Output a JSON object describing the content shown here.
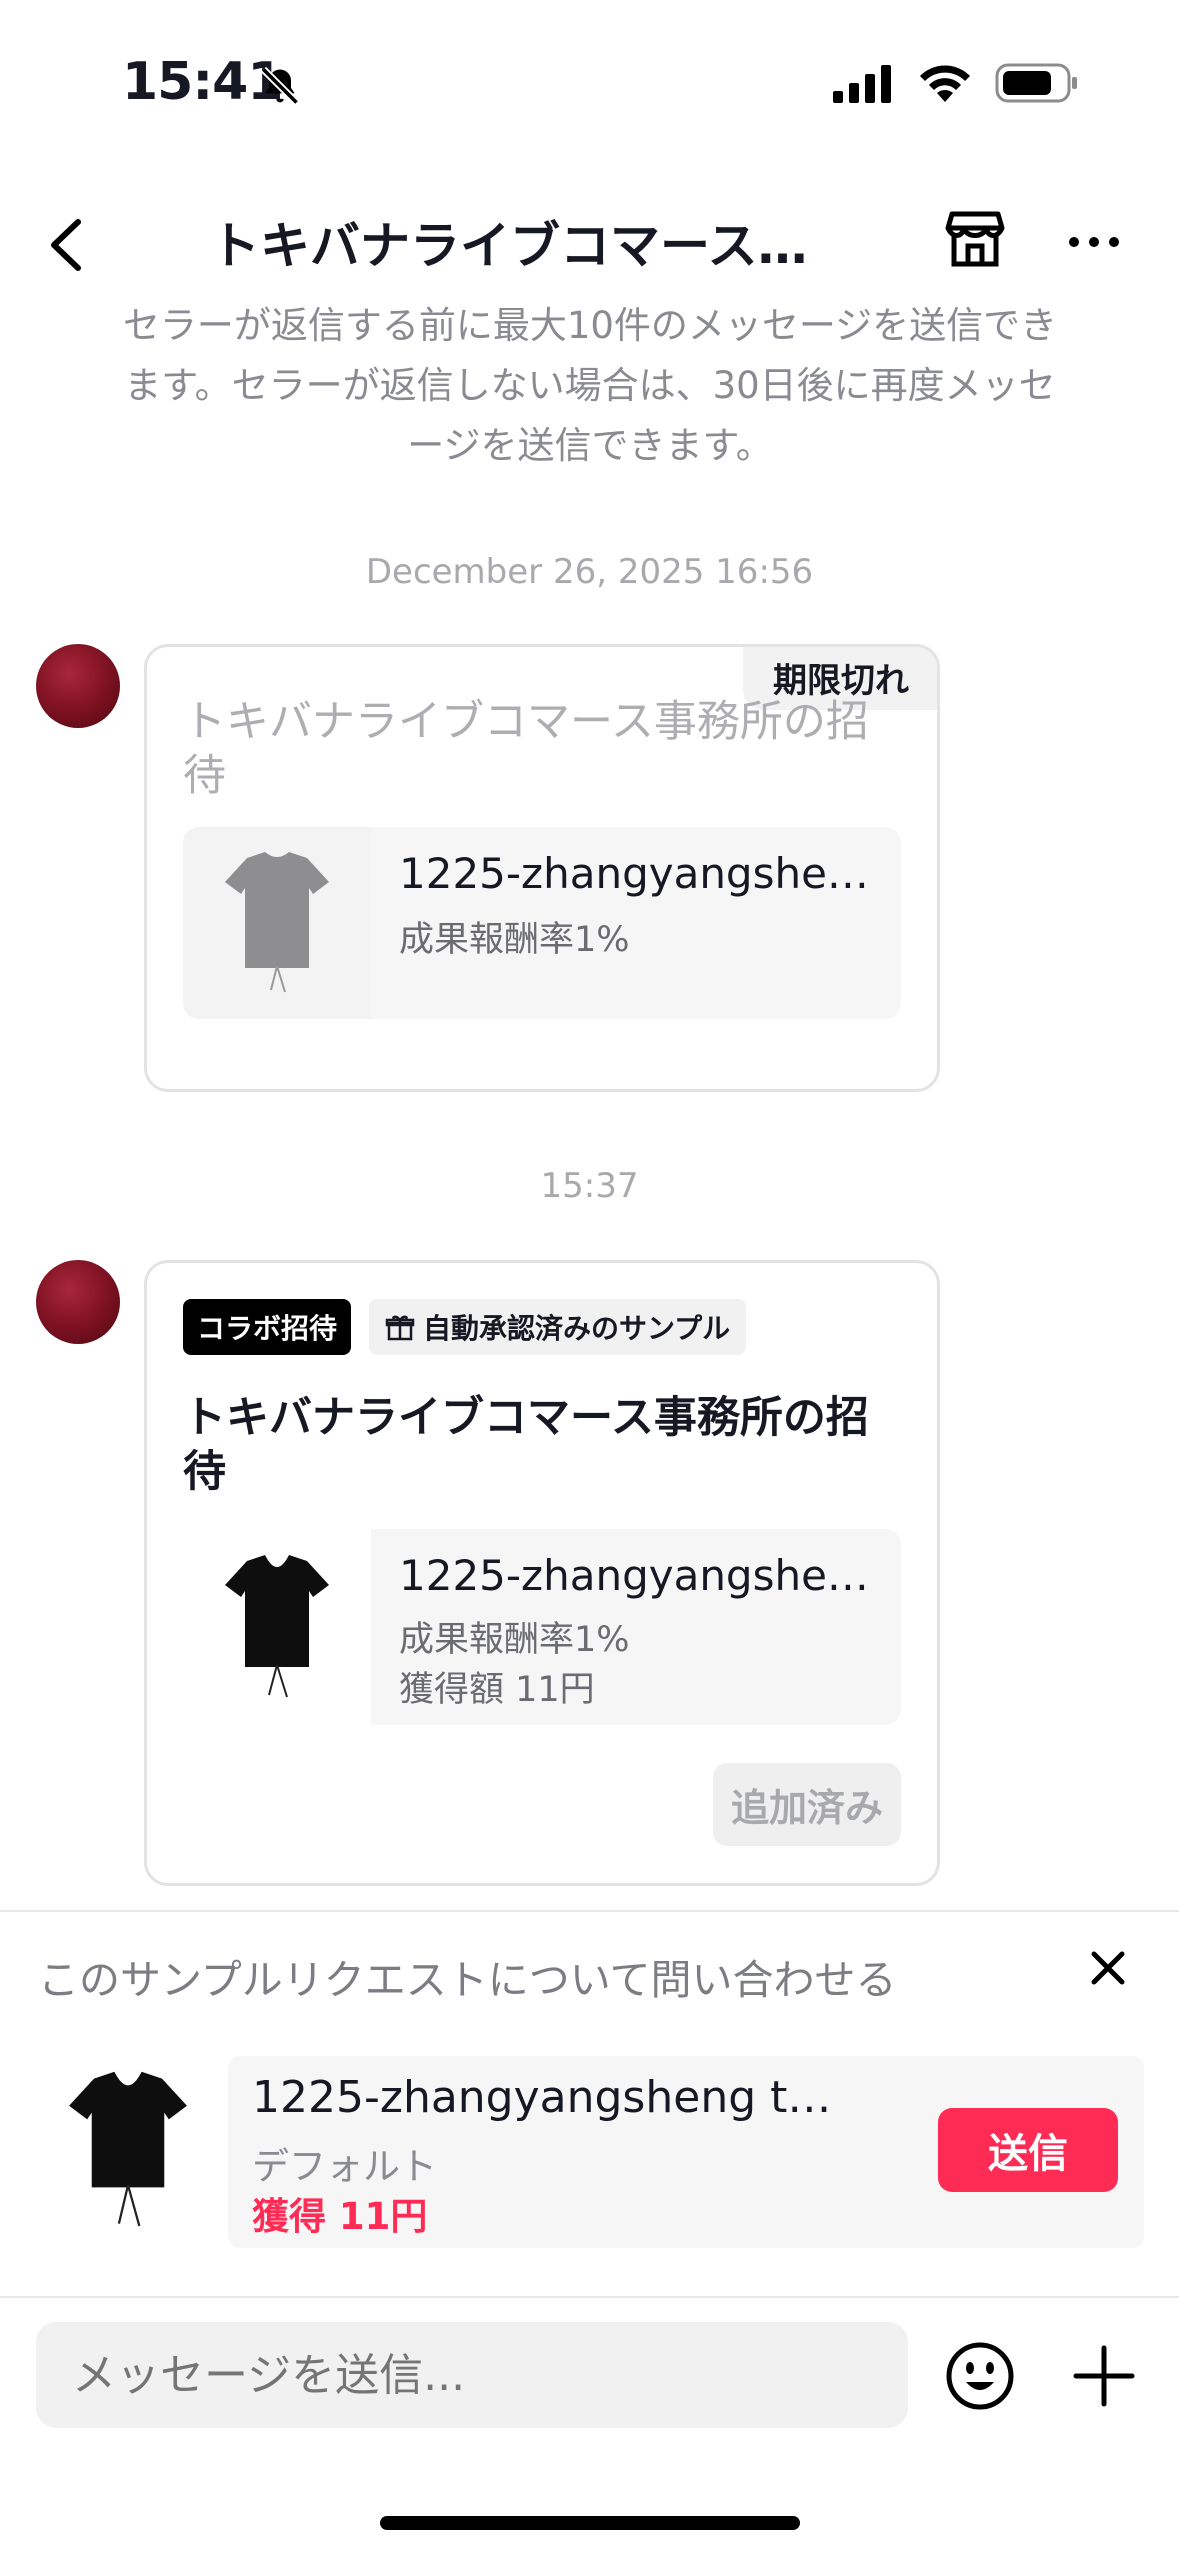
{
  "status_bar": {
    "time": "15:41"
  },
  "header": {
    "title": "トキバナライブコマース事…"
  },
  "notice": {
    "text": "セラーが返信する前に最大10件のメッセージを送信できます。セラーが返信しない場合は、30日後に再度メッセージを送信できます。"
  },
  "messages": [
    {
      "timestamp": "December 26, 2025 16:56",
      "badge": "期限切れ",
      "title": "トキバナライブコマース事務所の招待",
      "product": {
        "name": "1225-zhangyangshe…",
        "commission": "成果報酬率1%"
      }
    },
    {
      "timestamp": "15:37",
      "tag_collab": "コラボ招待",
      "tag_sample": "自動承認済みのサンプル",
      "title": "トキバナライブコマース事務所の招待",
      "product": {
        "name": "1225-zhangyangshe…",
        "commission": "成果報酬率1%",
        "earnings": "獲得額 11円"
      },
      "action": "追加済み"
    }
  ],
  "inquiry": {
    "title": "このサンプルリクエストについて問い合わせる",
    "product_name": "1225-zhangyangsheng test …",
    "variant": "デフォルト",
    "earnings": "獲得 11円",
    "send_label": "送信"
  },
  "composer": {
    "placeholder": "メッセージを送信..."
  },
  "colors": {
    "accent": "#fe2c55",
    "avatar": "#7a1020",
    "expired_text": "#aeaeb2"
  },
  "icons": [
    "bell-muted-icon",
    "signal-icon",
    "wifi-icon",
    "battery-icon",
    "back-arrow-icon",
    "shop-icon",
    "more-icon",
    "gift-icon",
    "close-icon",
    "emoji-icon",
    "plus-icon"
  ]
}
